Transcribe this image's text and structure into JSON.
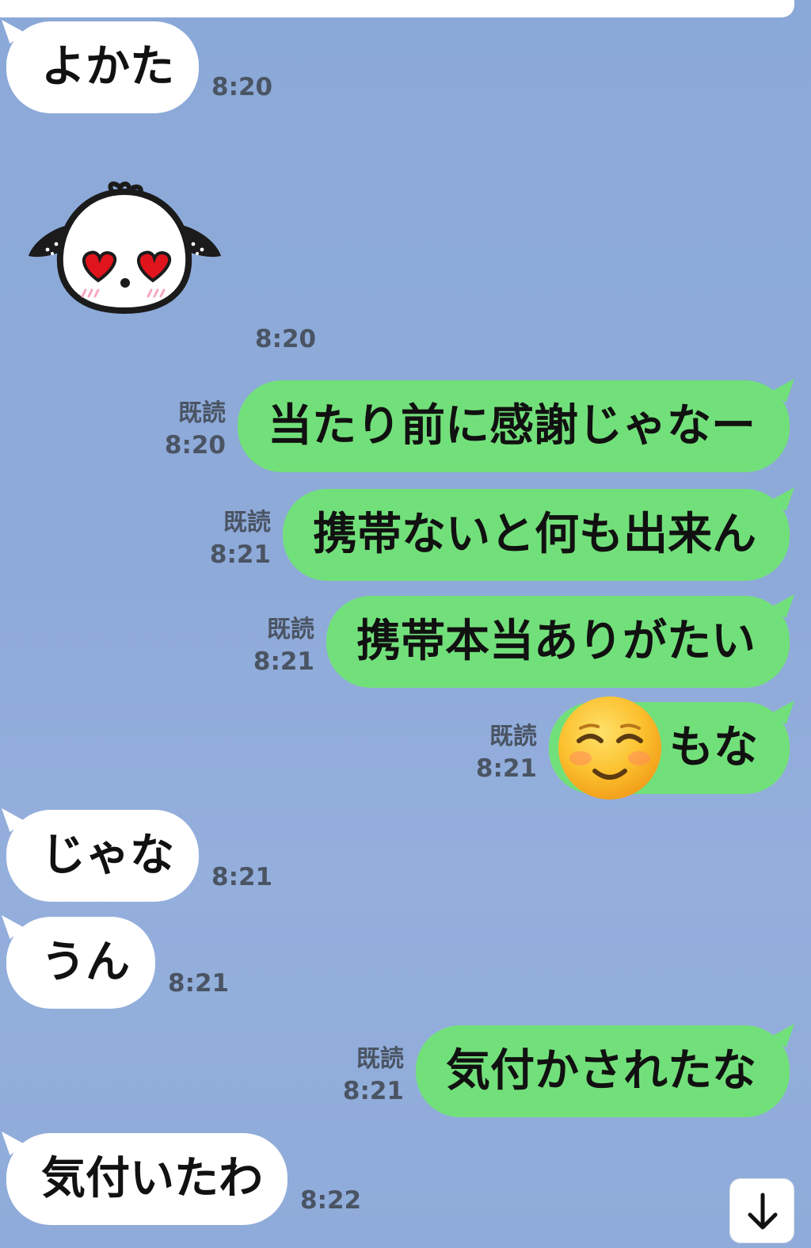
{
  "messages": [
    {
      "direction": "in",
      "text": "よかた",
      "time": "8:20"
    },
    {
      "direction": "in",
      "type": "sticker",
      "sticker_icon": "heart-eyes-dog-sticker",
      "time": "8:20"
    },
    {
      "direction": "out",
      "text": "当たり前に感謝じゃなー",
      "read": "既読",
      "time": "8:20"
    },
    {
      "direction": "out",
      "text": "携帯ないと何も出来ん",
      "read": "既読",
      "time": "8:21"
    },
    {
      "direction": "out",
      "text": "携帯本当ありがたい",
      "read": "既読",
      "time": "8:21"
    },
    {
      "direction": "out",
      "emoji": "smiling-face-emoji",
      "text": "もな",
      "read": "既読",
      "time": "8:21"
    },
    {
      "direction": "in",
      "text": "じゃな",
      "time": "8:21"
    },
    {
      "direction": "in",
      "text": "うん",
      "time": "8:21"
    },
    {
      "direction": "out",
      "text": "気付かされたな",
      "read": "既読",
      "time": "8:21"
    },
    {
      "direction": "in",
      "text": "気付いたわ",
      "time": "8:22"
    }
  ],
  "scroll_down_icon": "arrow-down-icon",
  "colors": {
    "background": "#8eaad9",
    "incoming_bubble": "#ffffff",
    "outgoing_bubble": "#72e07a",
    "meta_text": "#4a5463"
  }
}
